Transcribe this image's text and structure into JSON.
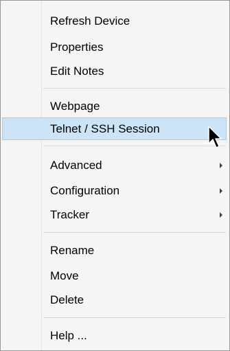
{
  "menu": {
    "groups": [
      {
        "items": [
          {
            "label": "Refresh Device"
          },
          {
            "label": "Properties"
          },
          {
            "label": "Edit Notes"
          }
        ]
      },
      {
        "items": [
          {
            "label": "Webpage"
          },
          {
            "label": "Telnet / SSH Session",
            "highlighted": true
          }
        ]
      },
      {
        "items": [
          {
            "label": "Advanced",
            "submenu": true
          },
          {
            "label": "Configuration",
            "submenu": true
          },
          {
            "label": "Tracker",
            "submenu": true
          }
        ]
      },
      {
        "items": [
          {
            "label": "Rename"
          },
          {
            "label": "Move"
          },
          {
            "label": "Delete"
          }
        ]
      },
      {
        "items": [
          {
            "label": "Help ..."
          }
        ]
      }
    ]
  },
  "colors": {
    "menu_background": "#f5f5f5",
    "highlight_background": "#cce4f7",
    "highlight_border": "#a9cbe8",
    "border": "#979797"
  },
  "icons": {
    "cursor": "mouse-pointer-icon",
    "submenu": "submenu-arrow-icon"
  }
}
